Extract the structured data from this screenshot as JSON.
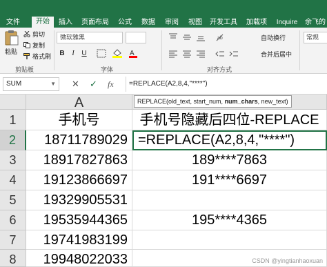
{
  "ribbon": {
    "tabs": [
      "文件",
      "开始",
      "插入",
      "页面布局",
      "公式",
      "数据",
      "审阅",
      "视图",
      "开发工具",
      "加载项",
      "Inquire",
      "余飞的"
    ],
    "active_tab": "开始",
    "accent_color": "#217346",
    "clipboard": {
      "paste": "粘贴",
      "cut": "剪切",
      "copy": "复制",
      "format_painter": "格式刷",
      "group_label": "剪贴板"
    },
    "font": {
      "family": "微软雅黑",
      "bold": "B",
      "italic": "I",
      "underline": "U",
      "group_label": "字体"
    },
    "alignment": {
      "wrap_text": "自动换行",
      "merge_center": "合并后居中",
      "group_label": "对齐方式"
    },
    "number": {
      "format": "常规"
    }
  },
  "formula_bar": {
    "name_box": "SUM",
    "cancel": "✕",
    "enter": "✓",
    "fx": "fx",
    "formula": "=REPLACE(A2,8,4,\"****\")"
  },
  "tooltip": {
    "prefix": "REPLACE(old_text, start_num, ",
    "bold_arg": "num_chars",
    "suffix": ", new_text)"
  },
  "sheet": {
    "columns": [
      "A",
      "B"
    ],
    "rows": [
      {
        "num": "1",
        "a": "手机号",
        "b": "手机号隐藏后四位-REPLACE"
      },
      {
        "num": "2",
        "a": "18711789029",
        "b": "=REPLACE(A2,8,4,\"****\")"
      },
      {
        "num": "3",
        "a": "18917827863",
        "b": "189****7863"
      },
      {
        "num": "4",
        "a": "19123866697",
        "b": "191****6697"
      },
      {
        "num": "5",
        "a": "19329905531",
        "b": ""
      },
      {
        "num": "6",
        "a": "19535944365",
        "b": "195****4365"
      },
      {
        "num": "7",
        "a": "19741983199",
        "b": ""
      },
      {
        "num": "8",
        "a": "19948022033",
        "b": ""
      }
    ]
  },
  "watermark": "CSDN @yingtianhaoxuan"
}
